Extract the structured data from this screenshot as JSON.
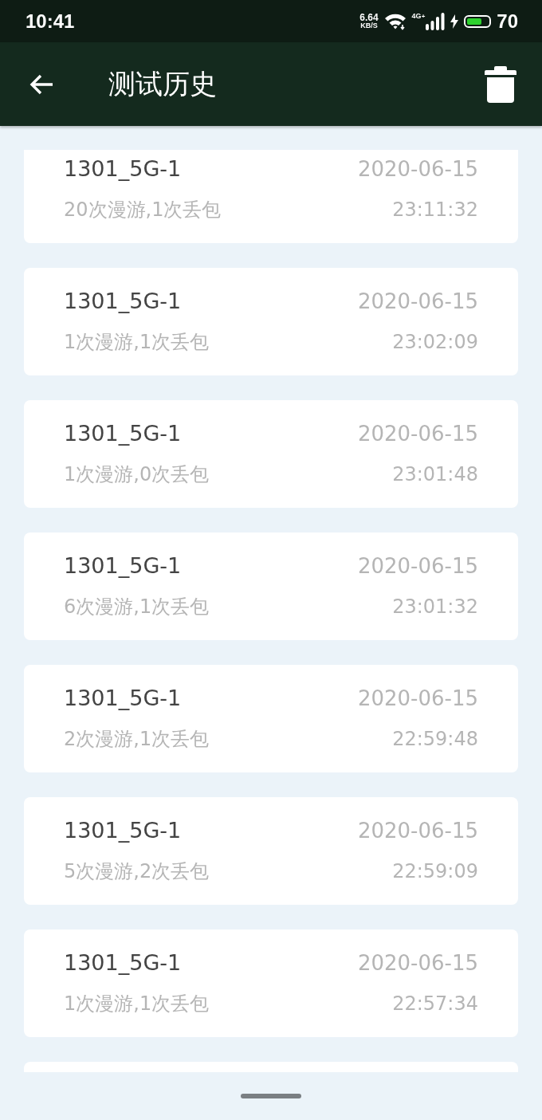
{
  "status_bar": {
    "time": "10:41",
    "net_speed": "6.64",
    "net_speed_unit": "KB/S",
    "network_type": "4G",
    "network_plus": "+",
    "battery": "70"
  },
  "app_bar": {
    "title": "测试历史"
  },
  "records": [
    {
      "name": "1301_5G-1",
      "summary": "20次漫游,1次丢包",
      "date": "2020-06-15",
      "time": "23:11:32"
    },
    {
      "name": "1301_5G-1",
      "summary": "1次漫游,1次丢包",
      "date": "2020-06-15",
      "time": "23:02:09"
    },
    {
      "name": "1301_5G-1",
      "summary": "1次漫游,0次丢包",
      "date": "2020-06-15",
      "time": "23:01:48"
    },
    {
      "name": "1301_5G-1",
      "summary": "6次漫游,1次丢包",
      "date": "2020-06-15",
      "time": "23:01:32"
    },
    {
      "name": "1301_5G-1",
      "summary": "2次漫游,1次丢包",
      "date": "2020-06-15",
      "time": "22:59:48"
    },
    {
      "name": "1301_5G-1",
      "summary": "5次漫游,2次丢包",
      "date": "2020-06-15",
      "time": "22:59:09"
    },
    {
      "name": "1301_5G-1",
      "summary": "1次漫游,1次丢包",
      "date": "2020-06-15",
      "time": "22:57:34"
    }
  ],
  "more_below": true
}
